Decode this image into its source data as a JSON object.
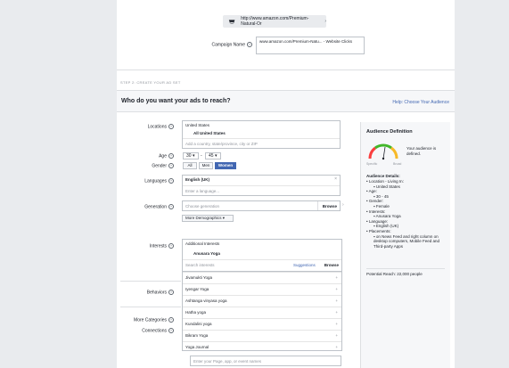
{
  "url_preview": {
    "text": "http://www.amazon.com/Premium-Natural-Or",
    "chevron": "›"
  },
  "campaign_name": {
    "label": "Campaign Name",
    "value": "www.amazon.com/Premium-Natu... - Website Clicks"
  },
  "section_label": "STEP 2: CREATE YOUR AD SET",
  "header": {
    "title": "Who do you want your ads to reach?",
    "help_link": "Help: Choose Your Audience"
  },
  "locations": {
    "label": "Locations",
    "country": "United States",
    "included": "All United States",
    "placeholder": "Add a country, state/province, city or ZIP"
  },
  "age": {
    "label": "Age",
    "min": "30",
    "max": "45"
  },
  "gender": {
    "label": "Gender",
    "options": [
      "All",
      "Men",
      "Women"
    ],
    "selected": "Women"
  },
  "languages": {
    "label": "Languages",
    "selected": "English (UK)",
    "placeholder": "Enter a language..."
  },
  "generation": {
    "label": "Generation",
    "placeholder": "Choose generation",
    "browse": "Browse",
    "more": "More Demographics ▾"
  },
  "interests": {
    "label": "Interests",
    "header": "Additional Interests",
    "selected": "Anusara Yoga",
    "search_placeholder": "Search interests",
    "suggestions": "Suggestions",
    "browse": "Browse",
    "items": [
      "Jivamukti Yoga",
      "Iyengar Yoga",
      "Ashtanga vinyasa yoga",
      "Hatha yoga",
      "Kundalini yoga",
      "Bikram Yoga",
      "Yoga Journal"
    ]
  },
  "behaviors": {
    "label": "Behaviors"
  },
  "more_categories": {
    "label": "More Categories"
  },
  "connections": {
    "label": "Connections",
    "placeholder": "Enter your Page, app, or event names"
  },
  "audience": {
    "title": "Audience Definition",
    "gauge_left": "Specific",
    "gauge_right": "Broad",
    "status": "Your audience is defined.",
    "details_title": "Audience Details:",
    "details": [
      {
        "text": "Location - Living In:",
        "sub": [
          "United States"
        ]
      },
      {
        "text": "Age:",
        "sub": [
          "30 - 45"
        ]
      },
      {
        "text": "Gender:",
        "sub": [
          "Female"
        ]
      },
      {
        "text": "Interests:",
        "sub": [
          "Anusara Yoga"
        ]
      },
      {
        "text": "Language:",
        "sub": [
          "English (UK)"
        ]
      },
      {
        "text": "Placements:",
        "sub": [
          "on News Feed and right column on desktop computers, Mobile Feed and Third-party Apps"
        ]
      }
    ],
    "reach": "Potential Reach: 22,000 people"
  },
  "colors": {
    "accent": "#4267b2",
    "gauge_green": "#42b72a",
    "gauge_red": "#fa3e3e",
    "gauge_yellow": "#f7b928"
  }
}
